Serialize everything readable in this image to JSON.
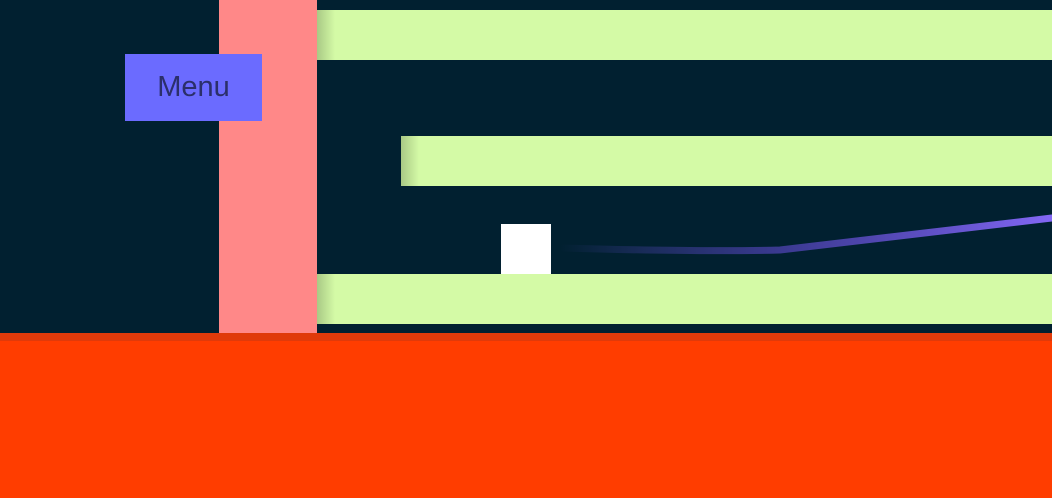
{
  "menu": {
    "label": "Menu"
  },
  "colors": {
    "background": "#012030",
    "wall": "#ff8888",
    "platform": "#d4faa6",
    "player": "#ffffff",
    "lava": "#ff3d00",
    "menu_button": "#6b6bff",
    "trail": "#7a5cff"
  }
}
